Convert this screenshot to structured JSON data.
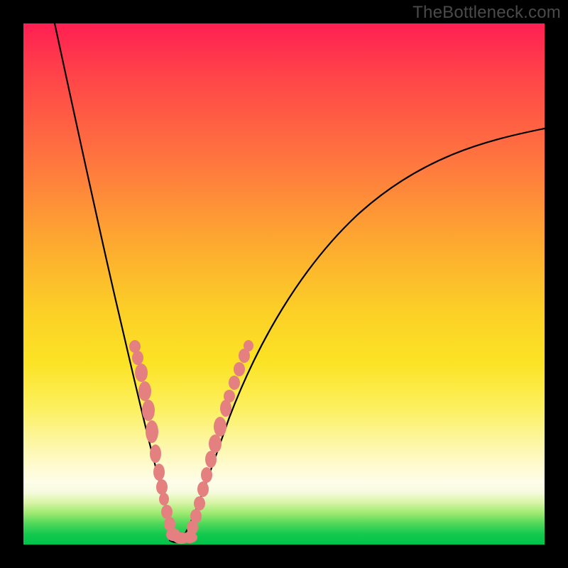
{
  "watermark": "TheBottleneck.com",
  "colors": {
    "background": "#000000",
    "gradient_top": "#ff1f52",
    "gradient_mid": "#fccf27",
    "gradient_bottom": "#00c24a",
    "curve": "#000000",
    "blobs": "#e58080"
  },
  "chart_data": {
    "type": "line",
    "title": "",
    "xlabel": "",
    "ylabel": "",
    "xlim": [
      0,
      100
    ],
    "ylim": [
      0,
      100
    ],
    "note": "Axes unlabeled; values are approximate pixel-normalized coordinates (0=left/bottom, 100=right/top) of the single bottleneck curve.",
    "series": [
      {
        "name": "bottleneck-curve",
        "x": [
          6,
          8,
          10,
          12,
          14,
          16,
          18,
          20,
          22,
          24,
          25,
          26,
          27,
          28,
          29,
          30,
          32,
          34,
          36,
          40,
          45,
          50,
          55,
          60,
          65,
          70,
          75,
          80,
          85,
          90,
          95,
          100
        ],
        "y": [
          100,
          90,
          80,
          71,
          62,
          54,
          46,
          38,
          30,
          22,
          17,
          12,
          8,
          4,
          2,
          1,
          1,
          3,
          6,
          12,
          22,
          31,
          39,
          46,
          53,
          59,
          64,
          68,
          72,
          75,
          78,
          80
        ]
      }
    ],
    "highlighted_points": {
      "name": "data-blobs",
      "note": "Pink blobs near the valley; same coordinate system as series.",
      "x": [
        19,
        20,
        21,
        22,
        23,
        24,
        25,
        26,
        27,
        28,
        29,
        30,
        31,
        32,
        33,
        34,
        35,
        36
      ],
      "y": [
        41,
        37,
        33,
        29,
        24,
        19,
        13,
        9,
        5,
        2,
        1,
        1,
        2,
        4,
        8,
        14,
        22,
        30
      ]
    }
  }
}
